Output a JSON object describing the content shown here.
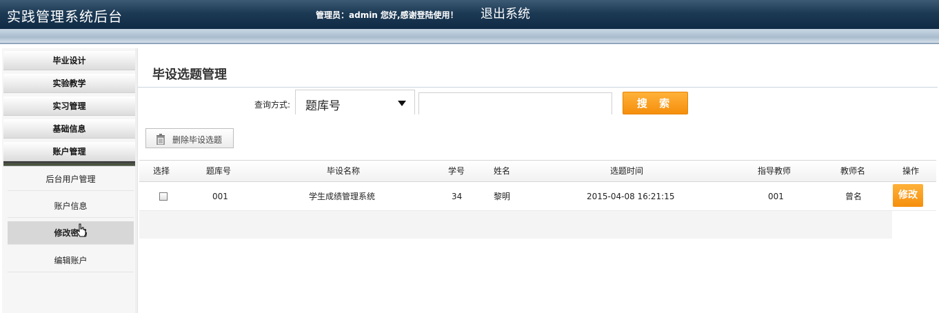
{
  "header": {
    "app_title": "实践管理系统后台",
    "greeting": "管理员：admin 您好,感谢登陆使用！",
    "logout_label": "退出系统"
  },
  "sidebar": {
    "categories": [
      {
        "label": "毕业设计"
      },
      {
        "label": "实验教学"
      },
      {
        "label": "实习管理"
      },
      {
        "label": "基础信息"
      },
      {
        "label": "账户管理"
      }
    ],
    "sub_items": [
      {
        "label": "后台用户管理"
      },
      {
        "label": "账户信息"
      },
      {
        "label": "修改密码",
        "active": true
      },
      {
        "label": "编辑账户"
      }
    ]
  },
  "main": {
    "page_title": "毕设选题管理",
    "query_label": "查询方式:",
    "query_select_value": "题库号",
    "search_value": "",
    "search_button": "搜 索",
    "delete_button": "删除毕设选题",
    "table": {
      "headers": [
        "选择",
        "题库号",
        "毕设名称",
        "学号",
        "姓名",
        "选题时间",
        "指导教师",
        "教师名",
        "操作"
      ],
      "rows": [
        {
          "checked": false,
          "bank_no": "001",
          "project_name": "学生成绩管理系统",
          "student_no": "34",
          "student_name": "黎明",
          "select_time": "2015-04-08 16:21:15",
          "advisor": "001",
          "teacher_name": "曾名",
          "action": "修改"
        }
      ]
    }
  },
  "colors": {
    "header_bg": "#1d3a55",
    "accent_orange": "#f58e0c"
  }
}
